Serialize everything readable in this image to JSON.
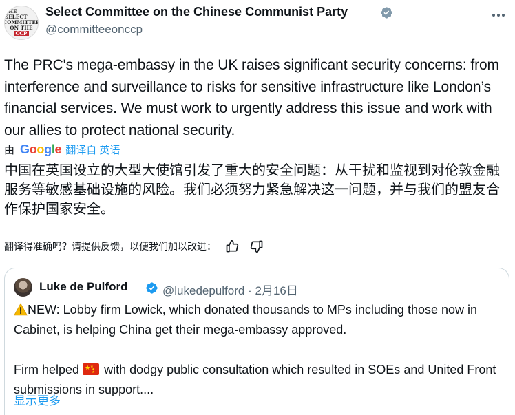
{
  "author": {
    "name": "Select Committee on the Chinese Communist Party",
    "handle": "@committeeonccp",
    "avatar_lines": [
      "THE SELECT",
      "COMMITTEE",
      "ON THE",
      "CCP"
    ]
  },
  "tweet": {
    "text": "The PRC's mega-embassy in the UK raises significant security concerns: from interference and surveillance to risks for sensitive infrastructure like London’s financial services. We must work to urgently address this issue and work with our allies to protect national security."
  },
  "translation": {
    "by_label": "由",
    "provider": "Google",
    "link_label": "翻译自 英语",
    "text": "中国在英国设立的大型大使馆引发了重大的安全问题：从干扰和监视到对伦敦金融服务等敏感基础设施的风险。我们必须努力紧急解决这一问题，并与我们的盟友合作保护国家安全。",
    "feedback_prompt": "翻译得准确吗？请提供反馈，以便我们加以改进："
  },
  "quote": {
    "name": "Luke de Pulford",
    "handle": "@lukedepulford",
    "separator": "·",
    "date": "2月16日",
    "line1": "NEW: Lobby firm Lowick, which donated thousands to MPs including those now in Cabinet, is helping China get their mega-embassy approved.",
    "line2_before": "Firm helped",
    "line2_after": "with dodgy public consultation which resulted in SOEs and United Front submissions in support....",
    "show_more": "显示更多"
  },
  "icons": [
    "verified-badge-icon",
    "more-options-icon",
    "thumbs-up-icon",
    "thumbs-down-icon",
    "warning-icon",
    "china-flag-icon"
  ],
  "colors": {
    "link": "#1d9bf0",
    "verified": "#829aab",
    "secondary_text": "#536471",
    "border": "#cfd9de"
  }
}
